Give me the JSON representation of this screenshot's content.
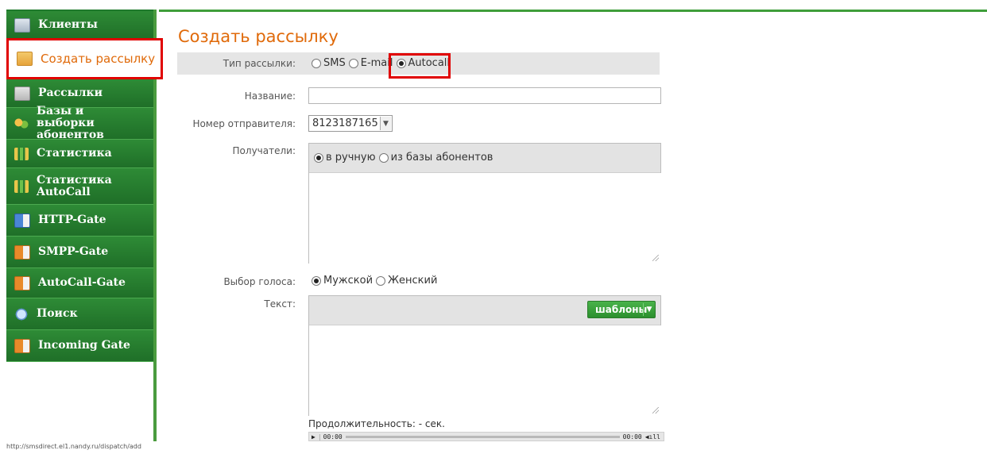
{
  "sidebar": {
    "items": [
      {
        "label": "Клиенты",
        "icon": "clients-icon"
      },
      {
        "label": "Создать рассылку",
        "icon": "envelope-icon"
      },
      {
        "label": "Рассылки",
        "icon": "mailings-icon"
      },
      {
        "label": "Базы и выборки абонентов",
        "icon": "users-icon"
      },
      {
        "label": "Статистика",
        "icon": "stats-icon"
      },
      {
        "label": "Статистика AutoCall",
        "icon": "stats-icon"
      },
      {
        "label": "HTTP-Gate",
        "icon": "gate-icon"
      },
      {
        "label": "SMPP-Gate",
        "icon": "gate-icon"
      },
      {
        "label": "AutoCall-Gate",
        "icon": "gate-icon"
      },
      {
        "label": "Поиск",
        "icon": "search-icon"
      },
      {
        "label": "Incoming Gate",
        "icon": "gate-icon"
      }
    ]
  },
  "page": {
    "title": "Создать рассылку"
  },
  "form": {
    "type_label": "Тип рассылки:",
    "type_options": [
      "SMS",
      "E-mail",
      "Autocall"
    ],
    "type_selected": "Autocall",
    "name_label": "Название:",
    "name_value": "",
    "sender_label": "Номер отправителя:",
    "sender_value": "8123187165",
    "recipients_label": "Получатели:",
    "recipients_options": [
      "в ручную",
      "из базы абонентов"
    ],
    "recipients_selected": "в ручную",
    "voice_label": "Выбор голоса:",
    "voice_options": [
      "Мужской",
      "Женский"
    ],
    "voice_selected": "Мужской",
    "text_label": "Текст:",
    "templates_button": "шаблоны",
    "duration_text": "Продолжительность: - сек.",
    "player_start": "00:00",
    "player_end": "00:00"
  },
  "status_bar": {
    "url": "http://smsdirect.el1.nandy.ru/dispatch/add"
  },
  "colors": {
    "sidebar_green": "#1f7a2c",
    "title_orange": "#e06a0a",
    "highlight_red": "#e00000"
  }
}
